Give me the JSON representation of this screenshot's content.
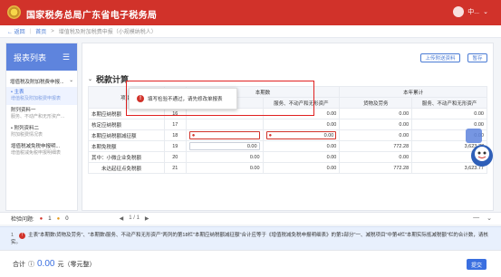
{
  "header": {
    "title": "国家税务总局广东省电子税务局",
    "user_name": "中...",
    "chevron": "⌄"
  },
  "breadcrumb": {
    "back": "← 返回",
    "sep": "|",
    "home": "首页",
    "arrow1": ">",
    "current": "增值税及附加税费申报（小规模纳税人）"
  },
  "sidebar": {
    "title": "报表列表",
    "menu_icon": "☰",
    "group": "增值税及附加税费申报...",
    "group_chevron": "⌄",
    "items": [
      {
        "title": "• 主表",
        "sub": "增值税及附加税费申报表"
      },
      {
        "title": "附列资料一",
        "sub": "服务、不动产和无形资产..."
      },
      {
        "title": "• 附列资料二",
        "sub": "附加税费情况表"
      },
      {
        "title": "增值税减免税申报明...",
        "sub": "增值税减免税申报明细表"
      }
    ]
  },
  "main": {
    "upload_label": "上传附送资料",
    "save_label": "暂存",
    "section_title": "税款计算",
    "section_chevron": "⌄",
    "table": {
      "h_item": "项 目",
      "h_lanci": "栏次",
      "h_current": "本期数",
      "h_cumulative": "本年累计",
      "h_goods": "货物及劳务",
      "h_service": "服务、不动产和无形资产",
      "rows": [
        {
          "label": "本期应纳税额",
          "lanci": "16",
          "c1": "",
          "c2": "0.00",
          "c3": "0.00",
          "c4": "0.00"
        },
        {
          "label": "核定应纳税额",
          "lanci": "17",
          "c1": "",
          "c2": "0.00",
          "c3": "0.00",
          "c4": "0.00"
        },
        {
          "label": "本期应纳税额减征额",
          "lanci": "18",
          "c1": "",
          "c2": "0.00",
          "c3": "0.00",
          "c4": "0.00"
        },
        {
          "label": "本期免税额",
          "lanci": "19",
          "c1": "0.00",
          "c2": "0.00",
          "c3": "772.28",
          "c4": "3,623.77"
        },
        {
          "label": "其中：小微企业免税额",
          "lanci": "20",
          "c1": "0.00",
          "c2": "0.00",
          "c3": "0.00",
          "c4": "0.00"
        },
        {
          "label": "未达起征点免税额",
          "lanci": "21",
          "c1": "0.00",
          "c2": "0.00",
          "c3": "772.28",
          "c4": "3,623.77"
        }
      ]
    },
    "tooltip": "填写检验不通过，请先修改单报表"
  },
  "status_bar": {
    "label": "检验问题:",
    "error_count": "1",
    "warning_count": "0",
    "prev": "◀",
    "page": "1 / 1",
    "next": "▶",
    "collapse": "—",
    "chevron": "⌄"
  },
  "message": {
    "index": "1",
    "icon": "!",
    "text": "主表\"本期数\\货物及劳务\"、\"本期数\\服务、不动产和无形资产\"两列的第18栏\"本期应纳税额减征额\"合计应等于《增值税减免税申报明细表》的第1部分\"一、减税项目\"中第4栏\"本期实际抵减税额\"栏的合计数，请核实。"
  },
  "footer": {
    "label": "合计",
    "icon": "ⓘ",
    "amount": "0.00",
    "unit": "元（零元整）",
    "submit": "提交"
  },
  "colors": {
    "brand_red": "#d1322a",
    "primary_blue": "#3a6fe0",
    "error_border": "#e02020"
  }
}
